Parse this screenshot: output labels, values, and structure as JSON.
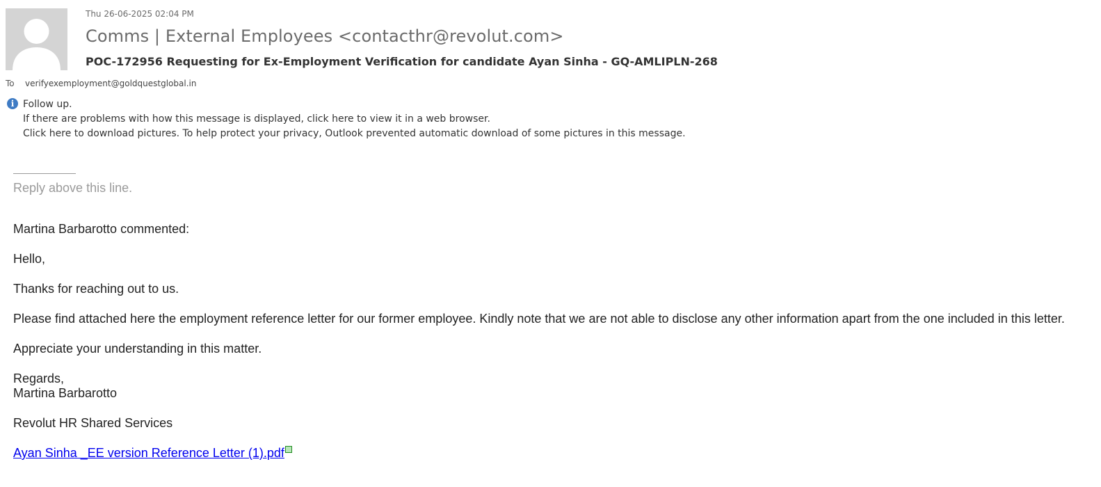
{
  "header": {
    "date": "Thu 26-06-2025 02:04 PM",
    "sender": "Comms | External Employees <contacthr@revolut.com>",
    "subject": "POC-172956 Requesting for Ex-Employment Verification for candidate Ayan Sinha - GQ-AMLIPLN-268",
    "to_label": "To",
    "to_value": "verifyexemployment@goldquestglobal.in"
  },
  "info_bar": {
    "icon": "info-icon",
    "follow_up": "Follow up.",
    "view_in_browser": "If there are problems with how this message is displayed, click here to view it in a web browser.",
    "download_pictures": "Click here to download pictures. To help protect your privacy, Outlook prevented automatic download of some pictures in this message."
  },
  "body": {
    "reply_line": "Reply above this line.",
    "commented": "Martina Barbarotto commented:",
    "greeting": "Hello,",
    "thanks": "Thanks for reaching out to us.",
    "main": "Please find attached here the employment reference letter for our former employee. Kindly note that we are not able to disclose any other information apart from the one included in this letter.",
    "appreciate": "Appreciate your understanding in this matter.",
    "regards": "Regards,",
    "signature_name": "Martina Barbarotto",
    "signature_team": "Revolut HR Shared Services",
    "attachment_link": "Ayan Sinha _EE version Reference Letter (1).pdf"
  },
  "colors": {
    "link": "#0000ee",
    "info_icon": "#3e7bc4",
    "muted": "#9a9a9a"
  }
}
